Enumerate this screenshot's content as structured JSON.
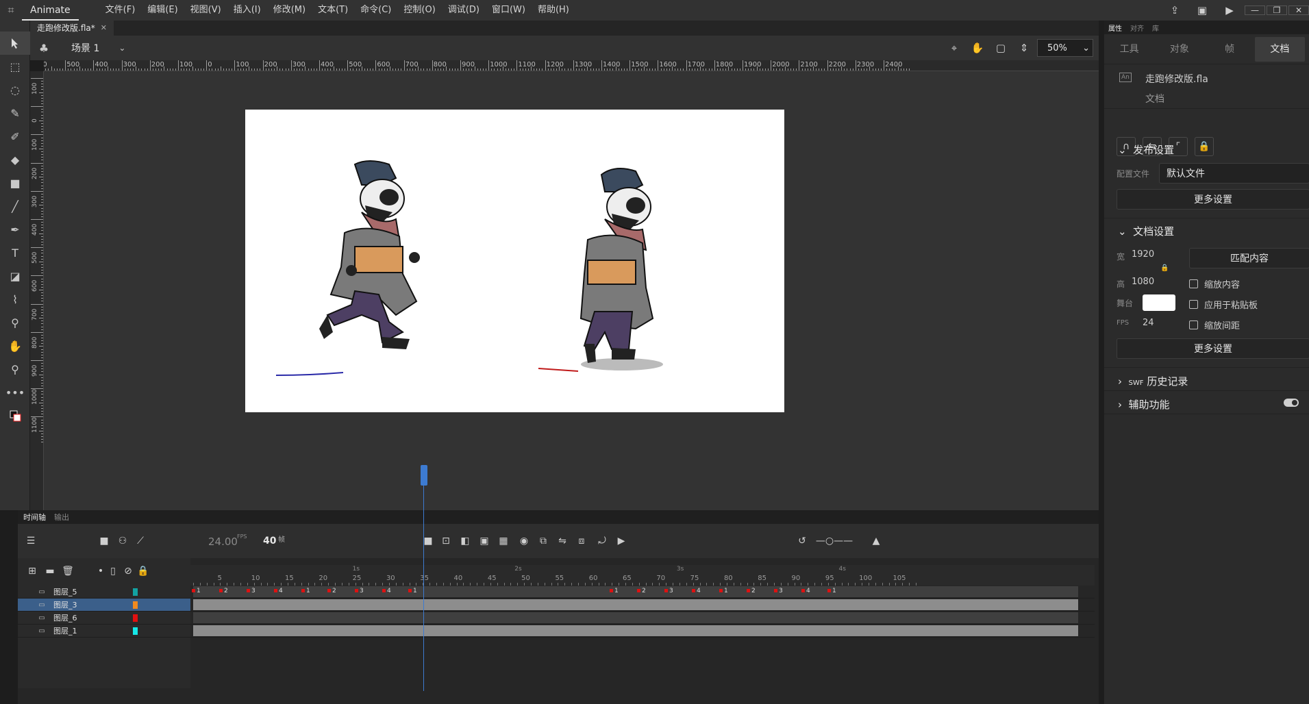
{
  "menubar": {
    "app_name": "Animate",
    "items": [
      "文件(F)",
      "编辑(E)",
      "视图(V)",
      "插入(I)",
      "修改(M)",
      "文本(T)",
      "命令(C)",
      "控制(O)",
      "调试(D)",
      "窗口(W)",
      "帮助(H)"
    ]
  },
  "document": {
    "tab_label": "走跑修改版.fla*",
    "scene_label": "场景 1",
    "zoom": "50%"
  },
  "ruler": {
    "h_labels": [
      "00",
      "500",
      "400",
      "300",
      "200",
      "100",
      "0",
      "100",
      "200",
      "300",
      "400",
      "500",
      "600",
      "700",
      "800",
      "900",
      "1000",
      "1100",
      "1200",
      "1300",
      "1400",
      "1500",
      "1600",
      "1700",
      "1800",
      "1900",
      "2000",
      "2100",
      "2200",
      "2300",
      "2400"
    ],
    "v_labels": [
      "100",
      "0",
      "100",
      "200",
      "300",
      "400",
      "500",
      "600",
      "700",
      "800",
      "900",
      "1000",
      "1100"
    ]
  },
  "timeline": {
    "tab_timeline": "时间轴",
    "tab_output": "输出",
    "fps": "24.00",
    "fps_unit": "FPS",
    "current_frame": "40",
    "frame_unit": "帧",
    "seconds": [
      "1s",
      "2s",
      "3s",
      "4s"
    ],
    "frame_numbers": [
      "5",
      "10",
      "15",
      "20",
      "25",
      "30",
      "35",
      "40",
      "45",
      "50",
      "55",
      "60",
      "65",
      "70",
      "75",
      "80",
      "85",
      "90",
      "95",
      "100",
      "105"
    ],
    "layers": [
      {
        "name": "图层_5",
        "color": "#12a3a3",
        "selected": false
      },
      {
        "name": "图层_3",
        "color": "#f08a1e",
        "selected": true
      },
      {
        "name": "图层_6",
        "color": "#e01010",
        "selected": false
      },
      {
        "name": "图层_1",
        "color": "#16e8e8",
        "selected": false
      }
    ],
    "keyframe_labels_row1": [
      "1",
      "2",
      "3",
      "4",
      "1",
      "2",
      "3",
      "4",
      "1",
      "1",
      "2",
      "3",
      "4",
      "1",
      "2",
      "3",
      "4",
      "1"
    ]
  },
  "properties": {
    "tab_properties": "属性",
    "tab_align": "对齐",
    "tab_library": "库",
    "subtabs": [
      "工具",
      "对象",
      "帧",
      "文档"
    ],
    "active_subtab": "文档",
    "doc_name": "走跑修改版.fla",
    "doc_type": "文档",
    "publish_section": "发布设置",
    "profile_label": "配置文件",
    "profile_value": "默认文件",
    "more_settings_1": "更多设置",
    "doc_section": "文档设置",
    "width_label": "宽",
    "width_value": "1920",
    "height_label": "高",
    "height_value": "1080",
    "match_content": "匹配内容",
    "scale_content": "缩放内容",
    "stage_label": "舞台",
    "apply_pasteboard": "应用于粘贴板",
    "fps_label": "FPS",
    "fps_value": "24",
    "scale_spacing": "缩放间距",
    "more_settings_2": "更多设置",
    "swf_label": "SWF",
    "history_section": "历史记录",
    "accessibility_section": "辅助功能"
  },
  "colors": {
    "stage": "#ffffff",
    "pasteboard": "#333333",
    "playhead": "#3d7bd1",
    "selected_layer": "#3b5f8a"
  }
}
